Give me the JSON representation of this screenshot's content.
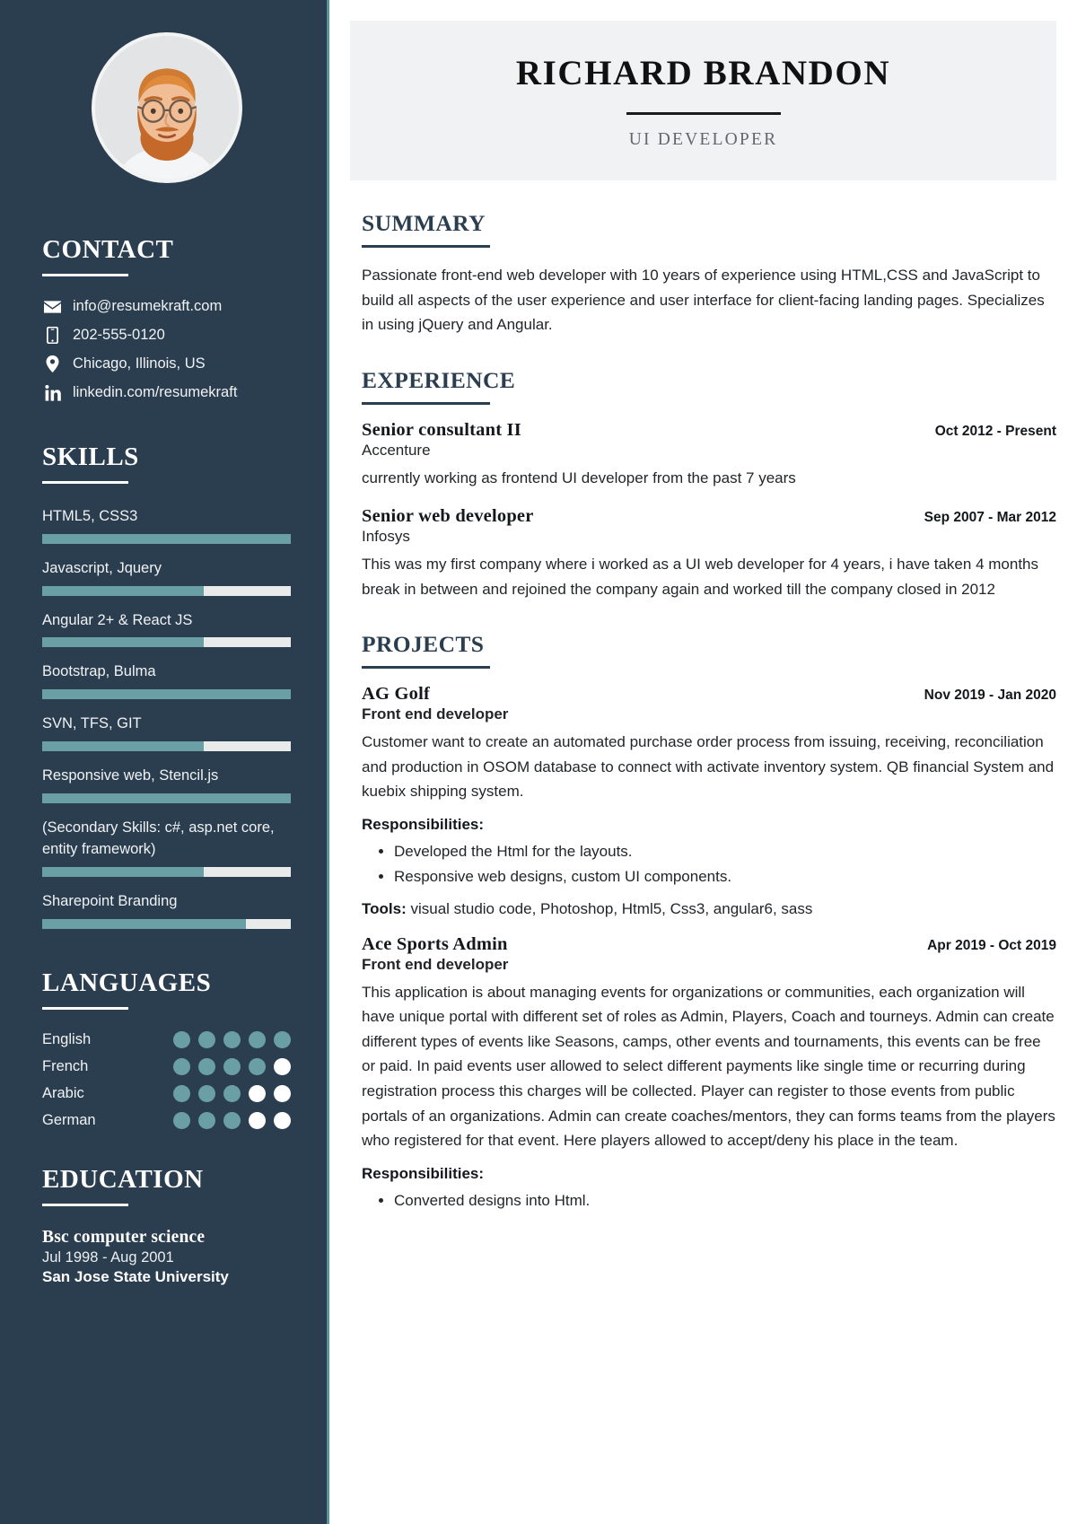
{
  "header": {
    "name": "RICHARD BRANDON",
    "job_title": "UI DEVELOPER"
  },
  "sidebar": {
    "photo_alt": "profile-photo",
    "contact": {
      "heading": "CONTACT",
      "items": [
        {
          "icon": "envelope-icon",
          "label": "info@resumekraft.com"
        },
        {
          "icon": "phone-icon",
          "label": "202-555-0120"
        },
        {
          "icon": "location-pin-icon",
          "label": "Chicago, Illinois, US"
        },
        {
          "icon": "linkedin-icon",
          "label": "linkedin.com/resumekraft"
        }
      ]
    },
    "skills": {
      "heading": "SKILLS",
      "items": [
        {
          "label": "HTML5, CSS3",
          "level": 100
        },
        {
          "label": "Javascript, Jquery",
          "level": 65
        },
        {
          "label": "Angular 2+ & React JS",
          "level": 65
        },
        {
          "label": "Bootstrap, Bulma",
          "level": 100
        },
        {
          "label": "SVN, TFS, GIT",
          "level": 65
        },
        {
          "label": "Responsive web, Stencil.js",
          "level": 100
        },
        {
          "label": "(Secondary Skills: c#, asp.net core, entity framework)",
          "level": 65
        },
        {
          "label": "Sharepoint Branding",
          "level": 82
        }
      ]
    },
    "languages": {
      "heading": "LANGUAGES",
      "max_dots": 5,
      "items": [
        {
          "label": "English",
          "level": 5
        },
        {
          "label": "French",
          "level": 4
        },
        {
          "label": "Arabic",
          "level": 3
        },
        {
          "label": "German",
          "level": 3
        }
      ]
    },
    "education": {
      "heading": "EDUCATION",
      "items": [
        {
          "degree": "Bsc computer science",
          "date": "Jul 1998 - Aug 2001",
          "school": "San Jose State University"
        }
      ]
    }
  },
  "main": {
    "summary": {
      "heading": "SUMMARY",
      "text": "Passionate front-end web developer with 10 years of experience using HTML,CSS and JavaScript to build all aspects of the user experience and user interface for client-facing landing pages. Specializes in using jQuery and Angular."
    },
    "experience": {
      "heading": "EXPERIENCE",
      "items": [
        {
          "title": "Senior consultant II",
          "date": "Oct 2012 - Present",
          "company": "Accenture",
          "description": "currently working as frontend UI developer from the past 7 years"
        },
        {
          "title": "Senior web developer",
          "date": "Sep 2007 - Mar 2012",
          "company": "Infosys",
          "description": "This was my first company where i worked as a UI web developer for 4 years, i have taken 4 months break in between and rejoined the company again and worked till the company closed in 2012"
        }
      ]
    },
    "projects": {
      "heading": "PROJECTS",
      "items": [
        {
          "title": "AG Golf",
          "date": "Nov 2019 - Jan 2020",
          "role": "Front end developer",
          "description": "Customer want to create an automated purchase order process from issuing, receiving, reconciliation and production in OSOM database to connect with activate inventory system. QB financial System and kuebix shipping system.",
          "responsibilities_label": "Responsibilities:",
          "responsibilities": [
            "Developed the Html for the layouts.",
            "Responsive web designs, custom UI components."
          ],
          "tools_label": "Tools:",
          "tools_value": " visual studio code, Photoshop, Html5, Css3, angular6, sass"
        },
        {
          "title": "Ace Sports Admin",
          "date": "Apr 2019 - Oct 2019",
          "role": "Front end developer",
          "description": "This application is about managing events for organizations or communities, each organization will have unique portal with different set of roles as Admin, Players, Coach and tourneys. Admin can create different types of events like Seasons, camps, other events and tournaments, this events can be free or paid. In paid events user allowed to select different payments like single time or recurring during registration process this charges will be collected. Player can register to those events from public portals of an organizations. Admin can create coaches/mentors, they can forms teams from the players who registered for that event. Here players allowed to accept/deny his place in the team.",
          "responsibilities_label": "Responsibilities:",
          "responsibilities": [
            "Converted designs into Html."
          ]
        }
      ]
    }
  },
  "colors": {
    "sidebar_bg": "#2b3e50",
    "accent": "#6a9fa6",
    "bar_track": "#e9eaea",
    "namecard_bg": "#f1f2f3",
    "heading": "#2b3e50"
  }
}
